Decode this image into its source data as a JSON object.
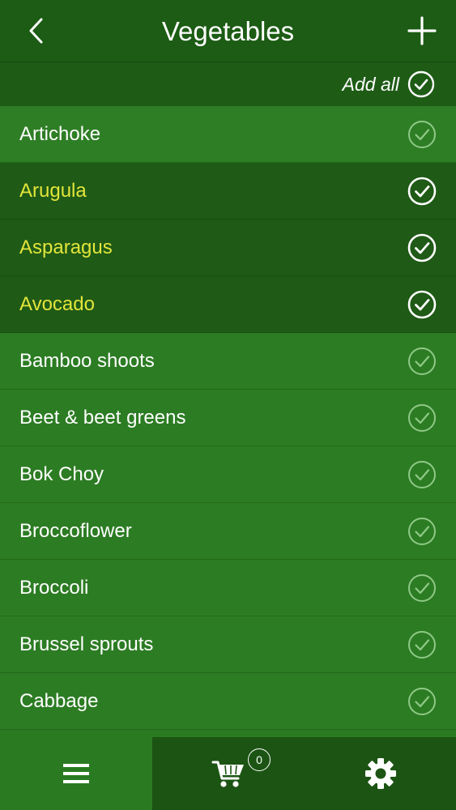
{
  "navbar": {
    "title": "Vegetables",
    "back_icon": "chevron-left-icon",
    "add_icon": "plus-icon"
  },
  "add_all": {
    "label": "Add all",
    "icon": "check-circle-icon"
  },
  "items": [
    {
      "label": "Artichoke",
      "selected": false
    },
    {
      "label": "Arugula",
      "selected": true
    },
    {
      "label": "Asparagus",
      "selected": true
    },
    {
      "label": "Avocado",
      "selected": true
    },
    {
      "label": "Bamboo shoots",
      "selected": false
    },
    {
      "label": "Beet & beet greens",
      "selected": false
    },
    {
      "label": "Bok Choy",
      "selected": false
    },
    {
      "label": "Broccoflower",
      "selected": false
    },
    {
      "label": "Broccoli",
      "selected": false
    },
    {
      "label": "Brussel sprouts",
      "selected": false
    },
    {
      "label": "Cabbage",
      "selected": false
    }
  ],
  "tabbar": {
    "lists_icon": "hamburger-menu-icon",
    "cart_icon": "shopping-cart-icon",
    "cart_count": "0",
    "settings_icon": "gear-icon"
  },
  "colors": {
    "navbar_bg": "#1c5c14",
    "row_bg": "#2c7c23",
    "row_selected_bg": "#1f5a16",
    "selected_text": "#e2e53a",
    "text": "#ffffff",
    "check_muted": "#8fc987"
  }
}
